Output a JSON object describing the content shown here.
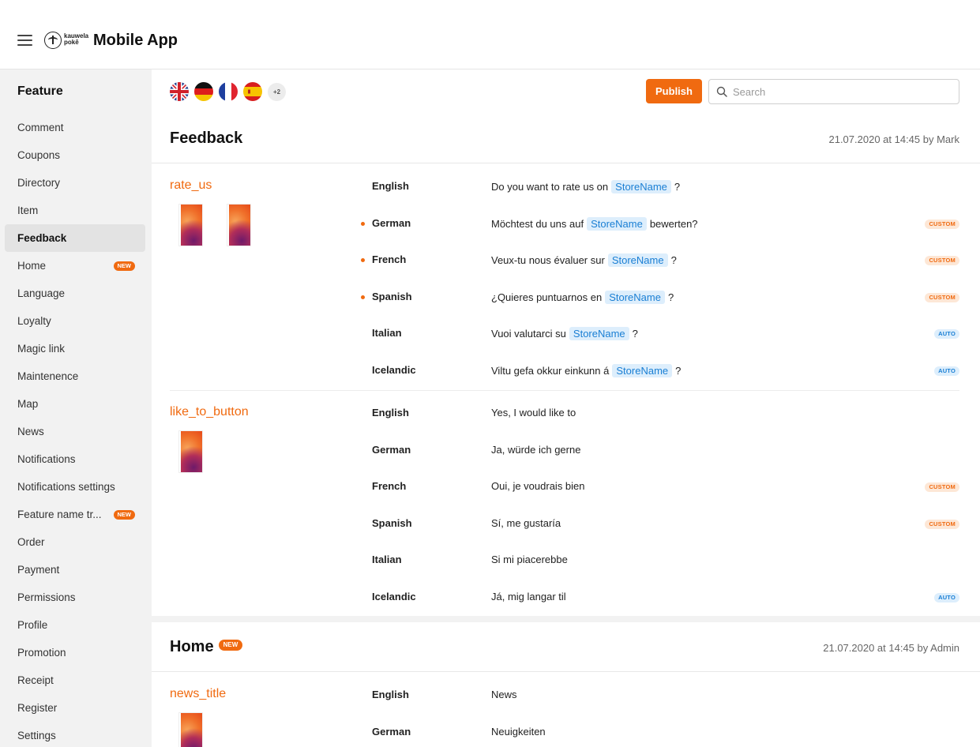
{
  "header": {
    "logo_text_line1": "kauwela",
    "logo_text_line2": "pokē",
    "app_title": "Mobile App"
  },
  "sidebar": {
    "title": "Feature",
    "items": [
      {
        "label": "Comment"
      },
      {
        "label": "Coupons"
      },
      {
        "label": "Directory"
      },
      {
        "label": "Item"
      },
      {
        "label": "Feedback",
        "active": true
      },
      {
        "label": "Home",
        "badge": "NEW"
      },
      {
        "label": "Language"
      },
      {
        "label": "Loyalty"
      },
      {
        "label": "Magic link"
      },
      {
        "label": "Maintenence"
      },
      {
        "label": "Map"
      },
      {
        "label": "News"
      },
      {
        "label": "Notifications"
      },
      {
        "label": "Notifications settings"
      },
      {
        "label": "Feature name tr...",
        "badge": "NEW"
      },
      {
        "label": "Order"
      },
      {
        "label": "Payment"
      },
      {
        "label": "Permissions"
      },
      {
        "label": "Profile"
      },
      {
        "label": "Promotion"
      },
      {
        "label": "Receipt"
      },
      {
        "label": "Register"
      },
      {
        "label": "Settings"
      }
    ]
  },
  "toolbar": {
    "flags": [
      "uk-flag-icon",
      "germany-flag-icon",
      "france-flag-icon",
      "spain-flag-icon"
    ],
    "more_languages": "+2",
    "publish_label": "Publish",
    "search_placeholder": "Search",
    "search_value": ""
  },
  "sections": [
    {
      "title": "Feedback",
      "badge": "",
      "meta": "21.07.2020 at 14:45 by Mark",
      "keys": [
        {
          "name": "rate_us",
          "screenshots": 2,
          "rows": [
            {
              "lang": "English",
              "before": "Do you want to rate us on",
              "token": "StoreName",
              "after": "?",
              "status": "",
              "modified": false
            },
            {
              "lang": "German",
              "before": "Möchtest du uns auf",
              "token": "StoreName",
              "after": "bewerten?",
              "status": "CUSTOM",
              "modified": true
            },
            {
              "lang": "French",
              "before": "Veux-tu nous évaluer sur",
              "token": "StoreName",
              "after": "?",
              "status": "CUSTOM",
              "modified": true
            },
            {
              "lang": "Spanish",
              "before": "¿Quieres puntuarnos en",
              "token": "StoreName",
              "after": "?",
              "status": "CUSTOM",
              "modified": true
            },
            {
              "lang": "Italian",
              "before": "Vuoi valutarci su",
              "token": "StoreName",
              "after": "?",
              "status": "AUTO",
              "modified": false
            },
            {
              "lang": "Icelandic",
              "before": "Viltu gefa okkur einkunn á",
              "token": "StoreName",
              "after": "?",
              "status": "AUTO",
              "modified": false
            }
          ]
        },
        {
          "name": "like_to_button",
          "screenshots": 1,
          "rows": [
            {
              "lang": "English",
              "before": "Yes, I would like to",
              "token": "",
              "after": "",
              "status": "",
              "modified": false
            },
            {
              "lang": "German",
              "before": "Ja, würde ich gerne",
              "token": "",
              "after": "",
              "status": "",
              "modified": false
            },
            {
              "lang": "French",
              "before": "Oui, je voudrais bien",
              "token": "",
              "after": "",
              "status": "CUSTOM",
              "modified": false
            },
            {
              "lang": "Spanish",
              "before": "Sí, me gustaría",
              "token": "",
              "after": "",
              "status": "CUSTOM",
              "modified": false
            },
            {
              "lang": "Italian",
              "before": "Si mi piacerebbe",
              "token": "",
              "after": "",
              "status": "",
              "modified": false
            },
            {
              "lang": "Icelandic",
              "before": "Já, mig langar til",
              "token": "",
              "after": "",
              "status": "AUTO",
              "modified": false
            }
          ]
        }
      ]
    },
    {
      "title": "Home",
      "badge": "NEW",
      "meta": "21.07.2020 at 14:45 by Admin",
      "keys": [
        {
          "name": "news_title",
          "screenshots": 1,
          "rows": [
            {
              "lang": "English",
              "before": "News",
              "token": "",
              "after": "",
              "status": "",
              "modified": false
            },
            {
              "lang": "German",
              "before": "Neuigkeiten",
              "token": "",
              "after": "",
              "status": "",
              "modified": false
            }
          ]
        }
      ]
    }
  ],
  "colors": {
    "accent": "#f06a10",
    "token_bg": "#ddeefc",
    "token_text": "#1a7fd4",
    "sidebar_bg": "#f2f2f2"
  }
}
